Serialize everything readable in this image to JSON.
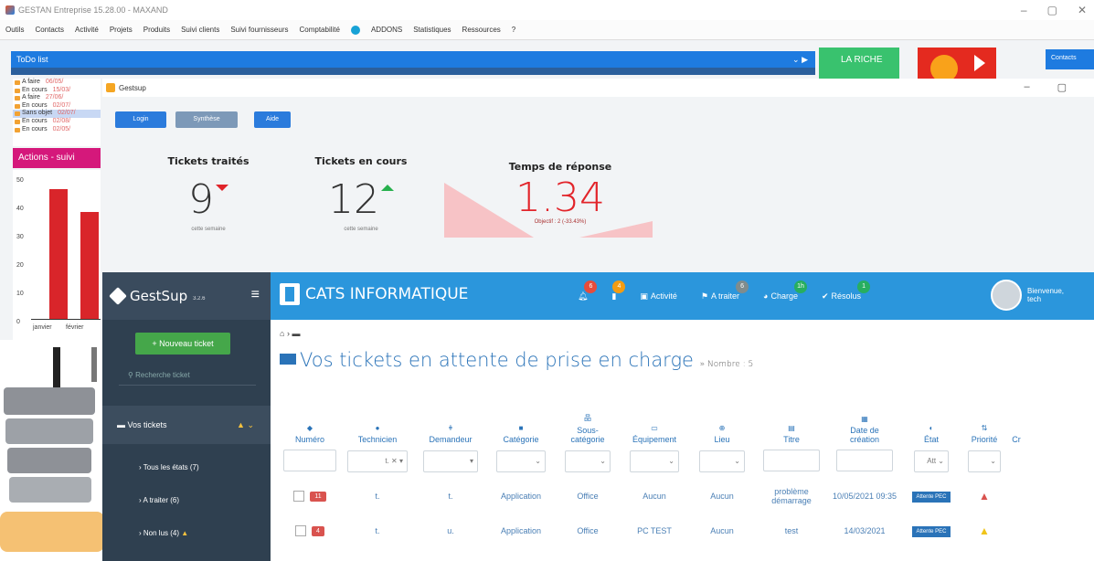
{
  "bg_app": {
    "title": "GESTAN Entreprise 15.28.00 - MAXAND",
    "menu": [
      "Outils",
      "Contacts",
      "Activité",
      "Projets",
      "Produits",
      "Suivi clients",
      "Suivi fournisseurs",
      "Comptabilité",
      "ADDONS",
      "Statistiques",
      "Ressources",
      "?"
    ],
    "todo_title": "ToDo list",
    "todo_items": [
      {
        "status": "A faire",
        "date": "06/05/"
      },
      {
        "status": "En cours",
        "date": "15/03/"
      },
      {
        "status": "A faire",
        "date": "27/06/"
      },
      {
        "status": "En cours",
        "date": "02/07/"
      },
      {
        "status": "Sans objet",
        "date": "02/07/"
      },
      {
        "status": "En cours",
        "date": "02/08/"
      },
      {
        "status": "En cours",
        "date": "02/05/"
      }
    ],
    "riche_label": "LA RICHE",
    "contacts_label": "Contacts",
    "actions_label": "Actions - suivi",
    "chart_y_ticks": [
      "50",
      "40",
      "30",
      "20",
      "10",
      "0"
    ],
    "chart_x_labels": [
      "janvier",
      "février"
    ],
    "chart_values": [
      46,
      38
    ]
  },
  "gestsup_window": {
    "title": "Gestsup",
    "buttons": [
      "Login",
      "Synthèse",
      "Aide"
    ]
  },
  "kpis": [
    {
      "label": "Tickets traités",
      "value": "9",
      "sub": "cette semaine",
      "trend": "down"
    },
    {
      "label": "Tickets en cours",
      "value": "12",
      "sub": "cette semaine",
      "trend": "up"
    },
    {
      "label": "Temps de réponse",
      "value": "1.34",
      "sub": "Objectif : 2 (-33.43%)"
    }
  ],
  "nav": {
    "brand": "GestSup",
    "version": "3.2.6",
    "company": "CATS INFORMATIQUE",
    "items": [
      {
        "label": "",
        "icon": "bell-icon",
        "badge": "6",
        "badge_color": "red"
      },
      {
        "label": "",
        "icon": "bookmark-icon",
        "badge": "4",
        "badge_color": "orange"
      },
      {
        "label": "Activité",
        "icon": "calendar-icon"
      },
      {
        "label": "A traiter",
        "icon": "flag-icon",
        "badge": "6",
        "badge_color": "grey"
      },
      {
        "label": "Charge",
        "icon": "dashboard-icon",
        "badge": "1h",
        "badge_color": "green"
      },
      {
        "label": "Résolus",
        "icon": "check-icon",
        "badge": "1",
        "badge_color": "green"
      }
    ],
    "user": "Bienvenue, tech"
  },
  "sidebar": {
    "new_ticket": "+ Nouveau ticket",
    "search_placeholder": "Recherche ticket",
    "section": "Vos tickets",
    "sub_items": [
      "Tous les états (7)",
      "A traiter (6)",
      "Non lus (4)"
    ]
  },
  "main": {
    "page_title": "Vos tickets en attente de prise en charge",
    "count_label": "» Nombre : 5",
    "columns": [
      "Numéro",
      "Technicien",
      "Demandeur",
      "Catégorie",
      "Sous-catégorie",
      "Équipement",
      "Lieu",
      "Titre",
      "Date de création",
      "État",
      "Priorité",
      "Cr"
    ],
    "filters": {
      "technicien": "t.",
      "etat": "Att"
    },
    "rows": [
      {
        "num": "11",
        "tech": "t.",
        "dem": "t.",
        "cat": "Application",
        "subcat": "Office",
        "equip": "Aucun",
        "lieu": "Aucun",
        "titre": "problème démarrage",
        "date": "10/05/2021 09:35",
        "etat": "Attente PEC",
        "prio": "red"
      },
      {
        "num": "4",
        "tech": "t.",
        "dem": "u.",
        "cat": "Application",
        "subcat": "Office",
        "equip": "PC TEST",
        "lieu": "Aucun",
        "titre": "test",
        "date": "14/03/2021",
        "etat": "Attente PEC",
        "prio": "yellow"
      }
    ]
  }
}
